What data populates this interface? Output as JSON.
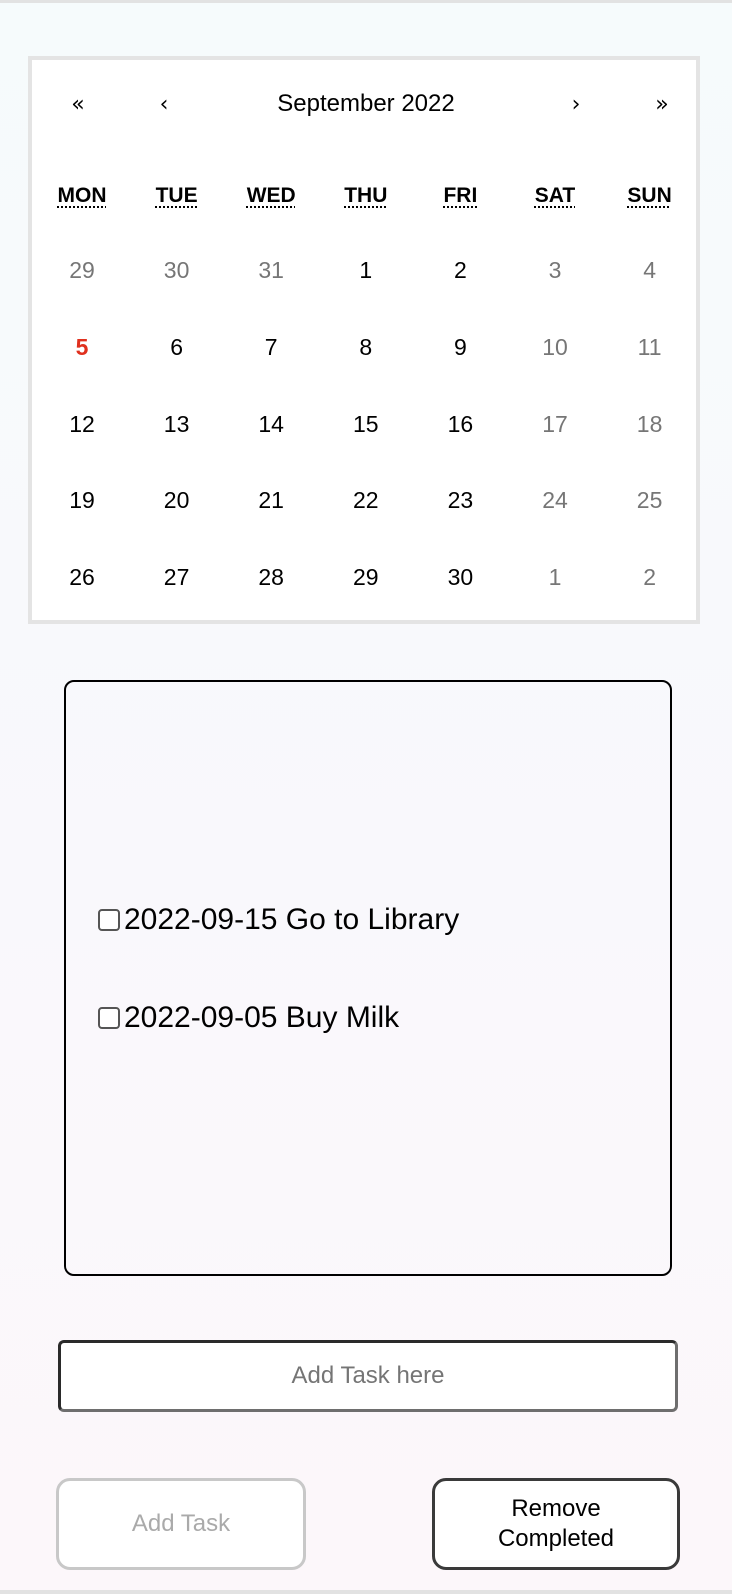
{
  "calendar": {
    "nav": {
      "prev2": "«",
      "prev": "‹",
      "label": "September 2022",
      "next": "›",
      "next2": "»"
    },
    "weekdays": [
      "MON",
      "TUE",
      "WED",
      "THU",
      "FRI",
      "SAT",
      "SUN"
    ],
    "weeks": [
      [
        {
          "d": "29",
          "m": true
        },
        {
          "d": "30",
          "m": true
        },
        {
          "d": "31",
          "m": true
        },
        {
          "d": "1"
        },
        {
          "d": "2"
        },
        {
          "d": "3",
          "m": true
        },
        {
          "d": "4",
          "m": true
        }
      ],
      [
        {
          "d": "5",
          "t": true
        },
        {
          "d": "6"
        },
        {
          "d": "7"
        },
        {
          "d": "8"
        },
        {
          "d": "9"
        },
        {
          "d": "10",
          "m": true
        },
        {
          "d": "11",
          "m": true
        }
      ],
      [
        {
          "d": "12"
        },
        {
          "d": "13"
        },
        {
          "d": "14"
        },
        {
          "d": "15"
        },
        {
          "d": "16"
        },
        {
          "d": "17",
          "m": true
        },
        {
          "d": "18",
          "m": true
        }
      ],
      [
        {
          "d": "19"
        },
        {
          "d": "20"
        },
        {
          "d": "21"
        },
        {
          "d": "22"
        },
        {
          "d": "23"
        },
        {
          "d": "24",
          "m": true
        },
        {
          "d": "25",
          "m": true
        }
      ],
      [
        {
          "d": "26"
        },
        {
          "d": "27"
        },
        {
          "d": "28"
        },
        {
          "d": "29"
        },
        {
          "d": "30"
        },
        {
          "d": "1",
          "m": true
        },
        {
          "d": "2",
          "m": true
        }
      ]
    ],
    "today_color": "#e0301e",
    "muted_color": "#767676"
  },
  "tasks": [
    {
      "text": "2022-09-15 Go to Library",
      "done": false
    },
    {
      "text": "2022-09-05 Buy Milk",
      "done": false
    }
  ],
  "input": {
    "value": "",
    "placeholder": "Add Task here"
  },
  "buttons": {
    "add": "Add Task",
    "remove_line1": "Remove",
    "remove_line2": "Completed"
  }
}
